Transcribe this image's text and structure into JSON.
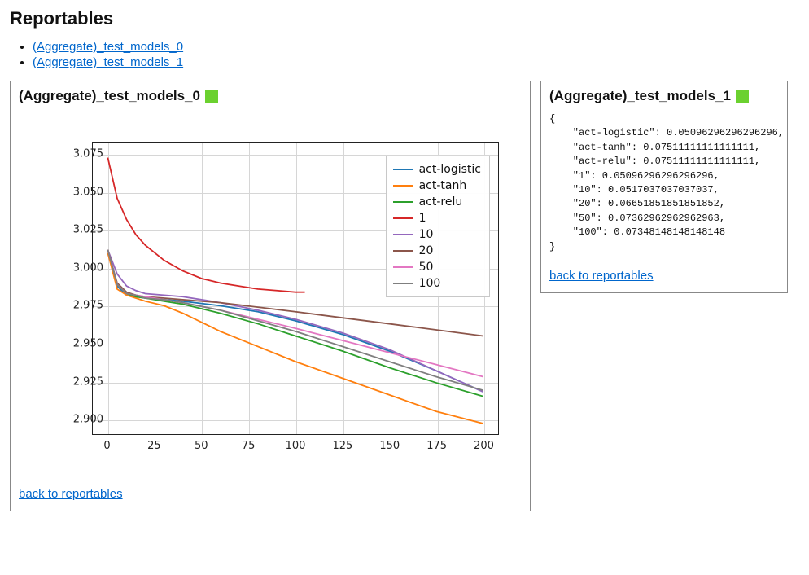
{
  "page_title": "Reportables",
  "toc": [
    "(Aggregate)_test_models_0",
    "(Aggregate)_test_models_1"
  ],
  "panels": {
    "left": {
      "title": "(Aggregate)_test_models_0",
      "status_color": "#6bd12f",
      "backlink": "back to reportables"
    },
    "right": {
      "title": "(Aggregate)_test_models_1",
      "status_color": "#6bd12f",
      "json_text": "{\n    \"act-logistic\": 0.05096296296296296,\n    \"act-tanh\": 0.07511111111111111,\n    \"act-relu\": 0.07511111111111111,\n    \"1\": 0.05096296296296296,\n    \"10\": 0.0517037037037037,\n    \"20\": 0.06651851851851852,\n    \"50\": 0.07362962962962963,\n    \"100\": 0.07348148148148148\n}",
      "backlink": "back to reportables"
    }
  },
  "chart_data": {
    "type": "line",
    "xlabel": "",
    "ylabel": "",
    "xlim": [
      -8,
      208
    ],
    "ylim": [
      2.89,
      3.083
    ],
    "xticks": [
      0,
      25,
      50,
      75,
      100,
      125,
      150,
      175,
      200
    ],
    "yticks": [
      2.9,
      2.925,
      2.95,
      2.975,
      3.0,
      3.025,
      3.05,
      3.075
    ],
    "legend_position": "upper-right",
    "colors": {
      "act-logistic": "#1f77b4",
      "act-tanh": "#ff7f0e",
      "act-relu": "#2ca02c",
      "1": "#d62728",
      "10": "#9467bd",
      "20": "#8c564b",
      "50": "#e377c2",
      "100": "#7f7f7f"
    },
    "series": [
      {
        "name": "act-logistic",
        "x": [
          0,
          5,
          10,
          15,
          20,
          30,
          40,
          60,
          80,
          100,
          125,
          150,
          175,
          200
        ],
        "y": [
          3.01,
          2.988,
          2.982,
          2.981,
          2.98,
          2.979,
          2.978,
          2.975,
          2.971,
          2.965,
          2.956,
          2.945,
          2.932,
          2.918
        ]
      },
      {
        "name": "act-tanh",
        "x": [
          0,
          5,
          10,
          15,
          20,
          30,
          40,
          60,
          80,
          100,
          125,
          150,
          175,
          200
        ],
        "y": [
          3.01,
          2.986,
          2.982,
          2.98,
          2.978,
          2.975,
          2.97,
          2.958,
          2.948,
          2.938,
          2.927,
          2.916,
          2.905,
          2.897
        ]
      },
      {
        "name": "act-relu",
        "x": [
          0,
          5,
          10,
          15,
          20,
          30,
          40,
          60,
          80,
          100,
          125,
          150,
          175,
          200
        ],
        "y": [
          3.012,
          2.989,
          2.983,
          2.981,
          2.98,
          2.978,
          2.976,
          2.97,
          2.963,
          2.955,
          2.945,
          2.934,
          2.924,
          2.915
        ]
      },
      {
        "name": "1",
        "x": [
          0,
          5,
          10,
          15,
          20,
          30,
          40,
          50,
          60,
          70,
          80,
          90,
          100,
          105
        ],
        "y": [
          3.073,
          3.046,
          3.032,
          3.022,
          3.015,
          3.005,
          2.998,
          2.993,
          2.99,
          2.988,
          2.986,
          2.985,
          2.984,
          2.984
        ]
      },
      {
        "name": "10",
        "x": [
          0,
          5,
          10,
          15,
          20,
          30,
          40,
          60,
          80,
          100,
          125,
          150,
          175,
          200
        ],
        "y": [
          3.012,
          2.996,
          2.988,
          2.985,
          2.983,
          2.982,
          2.981,
          2.977,
          2.972,
          2.966,
          2.957,
          2.946,
          2.932,
          2.918
        ]
      },
      {
        "name": "20",
        "x": [
          0,
          5,
          10,
          15,
          20,
          30,
          40,
          60,
          80,
          100,
          125,
          150,
          175,
          200
        ],
        "y": [
          3.012,
          2.99,
          2.984,
          2.982,
          2.981,
          2.98,
          2.979,
          2.977,
          2.974,
          2.971,
          2.967,
          2.963,
          2.959,
          2.955
        ]
      },
      {
        "name": "50",
        "x": [
          0,
          5,
          10,
          15,
          20,
          30,
          40,
          60,
          80,
          100,
          125,
          150,
          175,
          200
        ],
        "y": [
          3.012,
          2.989,
          2.983,
          2.982,
          2.981,
          2.979,
          2.977,
          2.972,
          2.966,
          2.96,
          2.952,
          2.944,
          2.936,
          2.928
        ]
      },
      {
        "name": "100",
        "x": [
          0,
          5,
          10,
          15,
          20,
          30,
          40,
          60,
          80,
          100,
          125,
          150,
          175,
          200
        ],
        "y": [
          3.012,
          2.989,
          2.983,
          2.982,
          2.98,
          2.979,
          2.977,
          2.972,
          2.965,
          2.958,
          2.948,
          2.938,
          2.928,
          2.919
        ]
      }
    ]
  }
}
